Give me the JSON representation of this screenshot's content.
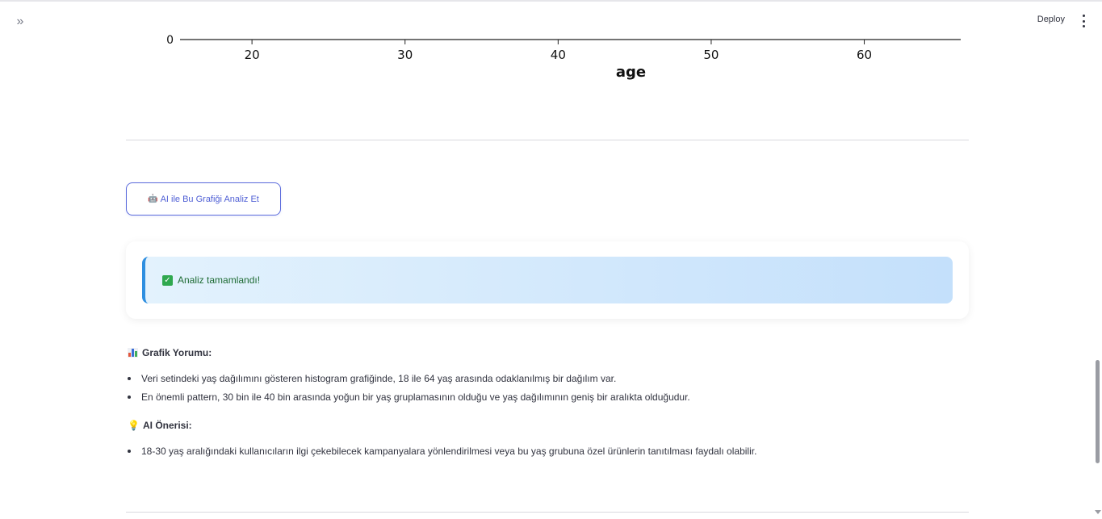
{
  "header": {
    "expand_icon": "double-chevron-right-icon",
    "deploy_label": "Deploy",
    "menu_icon": "kebab-menu-icon"
  },
  "chart_data": {
    "type": "bar",
    "xlabel": "age",
    "x_ticks": [
      "20",
      "30",
      "40",
      "50",
      "60"
    ],
    "x_tick_values": [
      20,
      30,
      40,
      50,
      60
    ],
    "xlim": [
      15.3,
      66.3
    ],
    "visible_y_tick": "0"
  },
  "analyze_button": {
    "icon": "robot-icon",
    "label": "AI ile Bu Grafiği Analiz Et"
  },
  "success_alert": {
    "icon": "check-box-icon",
    "text": "Analiz tamamlandı!",
    "accent_color": "#2f8fe0"
  },
  "interpretation": {
    "icon": "bar-chart-icon",
    "title": "Grafik Yorumu:",
    "items": [
      "Veri setindeki yaş dağılımını gösteren histogram grafiğinde, 18 ile 64 yaş arasında odaklanılmış bir dağılım var.",
      "En önemli pattern, 30 bin ile 40 bin arasında yoğun bir yaş gruplamasının olduğu ve yaş dağılımının geniş bir aralıkta olduğudur."
    ]
  },
  "recommendation": {
    "icon": "light-bulb-icon",
    "title": "AI Önerisi:",
    "items": [
      "18-30 yaş aralığındaki kullanıcıların ilgi çekebilecek kampanyalara yönlendirilmesi veya bu yaş grubuna özel ürünlerin tanıtılması faydalı olabilir."
    ]
  }
}
